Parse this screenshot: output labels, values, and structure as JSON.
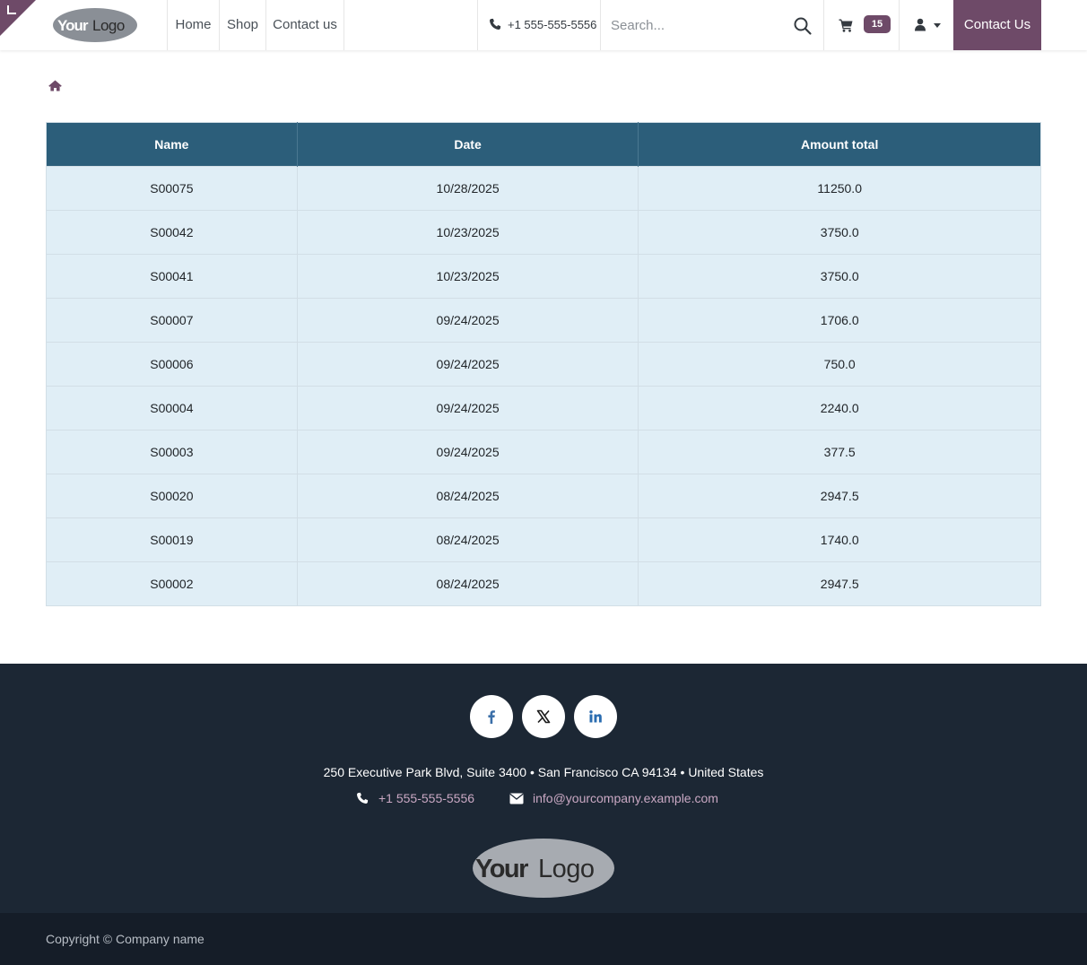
{
  "header": {
    "logo_text": "YourLogo",
    "nav": [
      "Home",
      "Shop",
      "Contact us"
    ],
    "phone": "+1 555-555-5556",
    "search_placeholder": "Search...",
    "cart_count": "15",
    "cta_label": "Contact Us",
    "icons": [
      "phone-icon",
      "search-icon",
      "cart-icon",
      "user-icon",
      "chevron-down-icon"
    ]
  },
  "breadcrumb": {
    "icon": "home-icon"
  },
  "table": {
    "columns": [
      "Name",
      "Date",
      "Amount total"
    ],
    "rows": [
      [
        "S00075",
        "10/28/2025",
        "11250.0"
      ],
      [
        "S00042",
        "10/23/2025",
        "3750.0"
      ],
      [
        "S00041",
        "10/23/2025",
        "3750.0"
      ],
      [
        "S00007",
        "09/24/2025",
        "1706.0"
      ],
      [
        "S00006",
        "09/24/2025",
        "750.0"
      ],
      [
        "S00004",
        "09/24/2025",
        "2240.0"
      ],
      [
        "S00003",
        "09/24/2025",
        "377.5"
      ],
      [
        "S00020",
        "08/24/2025",
        "2947.5"
      ],
      [
        "S00019",
        "08/24/2025",
        "1740.0"
      ],
      [
        "S00002",
        "08/24/2025",
        "2947.5"
      ]
    ]
  },
  "footer": {
    "social": [
      "facebook-icon",
      "x-icon",
      "linkedin-icon"
    ],
    "address": "250 Executive Park Blvd, Suite 3400 • San Francisco CA 94134 • United States",
    "phone": "+1 555-555-5556",
    "email": "info@yourcompany.example.com",
    "logo_text": "YourLogo",
    "copyright": "Copyright © Company name"
  },
  "colors": {
    "brand": "#6e4a68",
    "table_header": "#2c5e7a",
    "table_row": "#e0eef6",
    "footer_bg": "#1c2734",
    "footer_link": "#c9a8c3"
  }
}
